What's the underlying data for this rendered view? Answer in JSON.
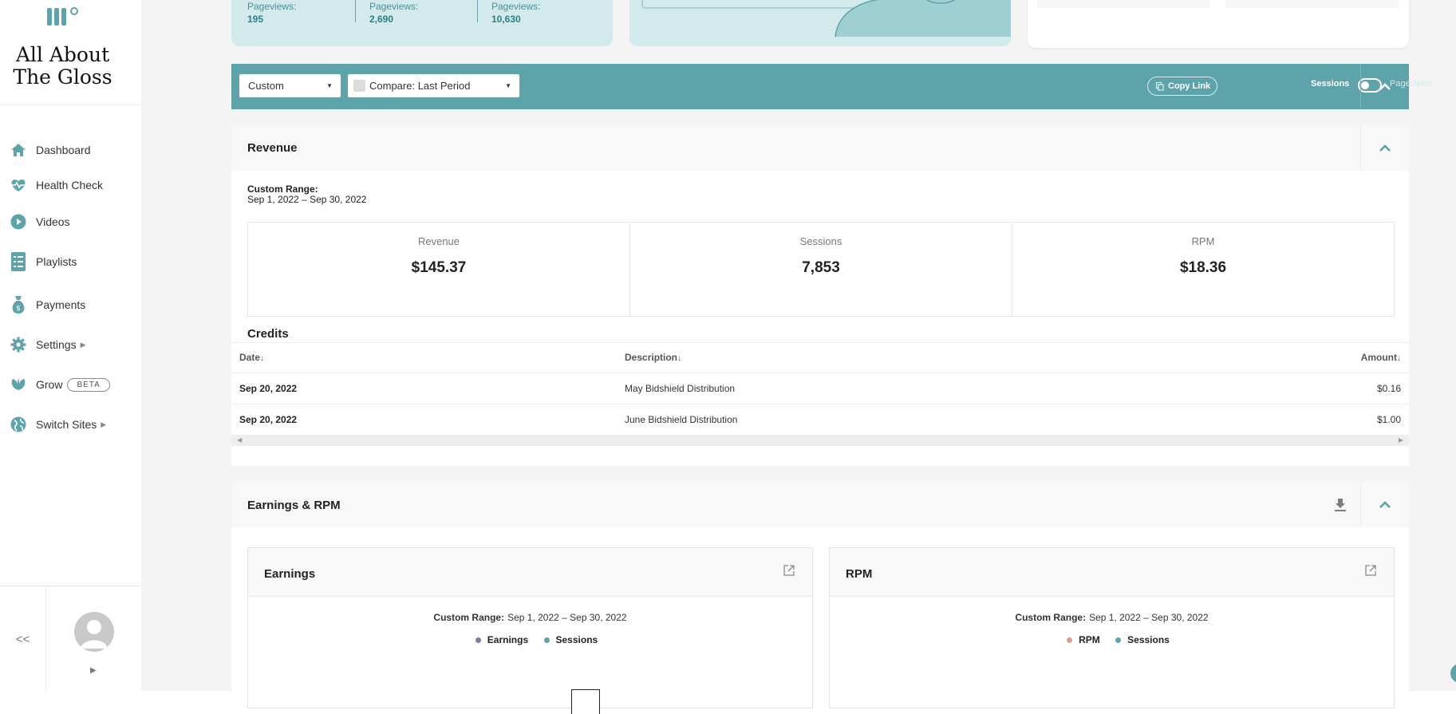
{
  "brand": {
    "name_line1": "All About",
    "name_line2": "The Gloss"
  },
  "sidebar": {
    "items": [
      {
        "label": "Dashboard",
        "icon": "home-icon"
      },
      {
        "label": "Health Check",
        "icon": "heartbeat-icon"
      },
      {
        "label": "Videos",
        "icon": "play-circle-icon"
      },
      {
        "label": "Playlists",
        "icon": "list-icon"
      },
      {
        "label": "Payments",
        "icon": "money-bag-icon"
      },
      {
        "label": "Settings",
        "icon": "gear-icon"
      },
      {
        "label": "Grow",
        "icon": "leaf-icon",
        "badge": "BETA"
      },
      {
        "label": "Switch Sites",
        "icon": "globe-icon"
      }
    ],
    "collapse_label": "<<"
  },
  "top_stats": [
    {
      "label": "Pageviews:",
      "value": "195"
    },
    {
      "label": "Pageviews:",
      "value": "2,690"
    },
    {
      "label": "Pageviews:",
      "value": "10,630"
    }
  ],
  "toolbar": {
    "range_select": "Custom",
    "compare_select": "Compare: Last Period",
    "copy_link": "Copy Link",
    "toggle_left": "Sessions",
    "toggle_right": "Pageviews"
  },
  "revenue": {
    "title": "Revenue",
    "range_label": "Custom Range:",
    "range_value": "Sep 1, 2022 – Sep 30, 2022",
    "metrics": [
      {
        "label": "Revenue",
        "value": "$145.37"
      },
      {
        "label": "Sessions",
        "value": "7,853"
      },
      {
        "label": "RPM",
        "value": "$18.36"
      }
    ],
    "credits_title": "Credits",
    "columns": {
      "date": "Date",
      "description": "Description",
      "amount": "Amount"
    },
    "rows": [
      {
        "date": "Sep 20, 2022",
        "description": "May Bidshield Distribution",
        "amount": "$0.16"
      },
      {
        "date": "Sep 20, 2022",
        "description": "June Bidshield Distribution",
        "amount": "$1.00"
      }
    ]
  },
  "earnings": {
    "title": "Earnings & RPM",
    "charts": [
      {
        "title": "Earnings",
        "range_label": "Custom Range:",
        "range_value": "Sep 1, 2022 – Sep 30, 2022",
        "legend": [
          {
            "name": "Earnings",
            "color": "#7a7f98"
          },
          {
            "name": "Sessions",
            "color": "#5fa3aa"
          }
        ]
      },
      {
        "title": "RPM",
        "range_label": "Custom Range:",
        "range_value": "Sep 1, 2022 – Sep 30, 2022",
        "legend": [
          {
            "name": "RPM",
            "color": "#d9a08f"
          },
          {
            "name": "Sessions",
            "color": "#5fa3aa"
          }
        ]
      }
    ]
  },
  "colors": {
    "accent": "#5fa3aa",
    "top_card_bg": "#d3eaec"
  }
}
